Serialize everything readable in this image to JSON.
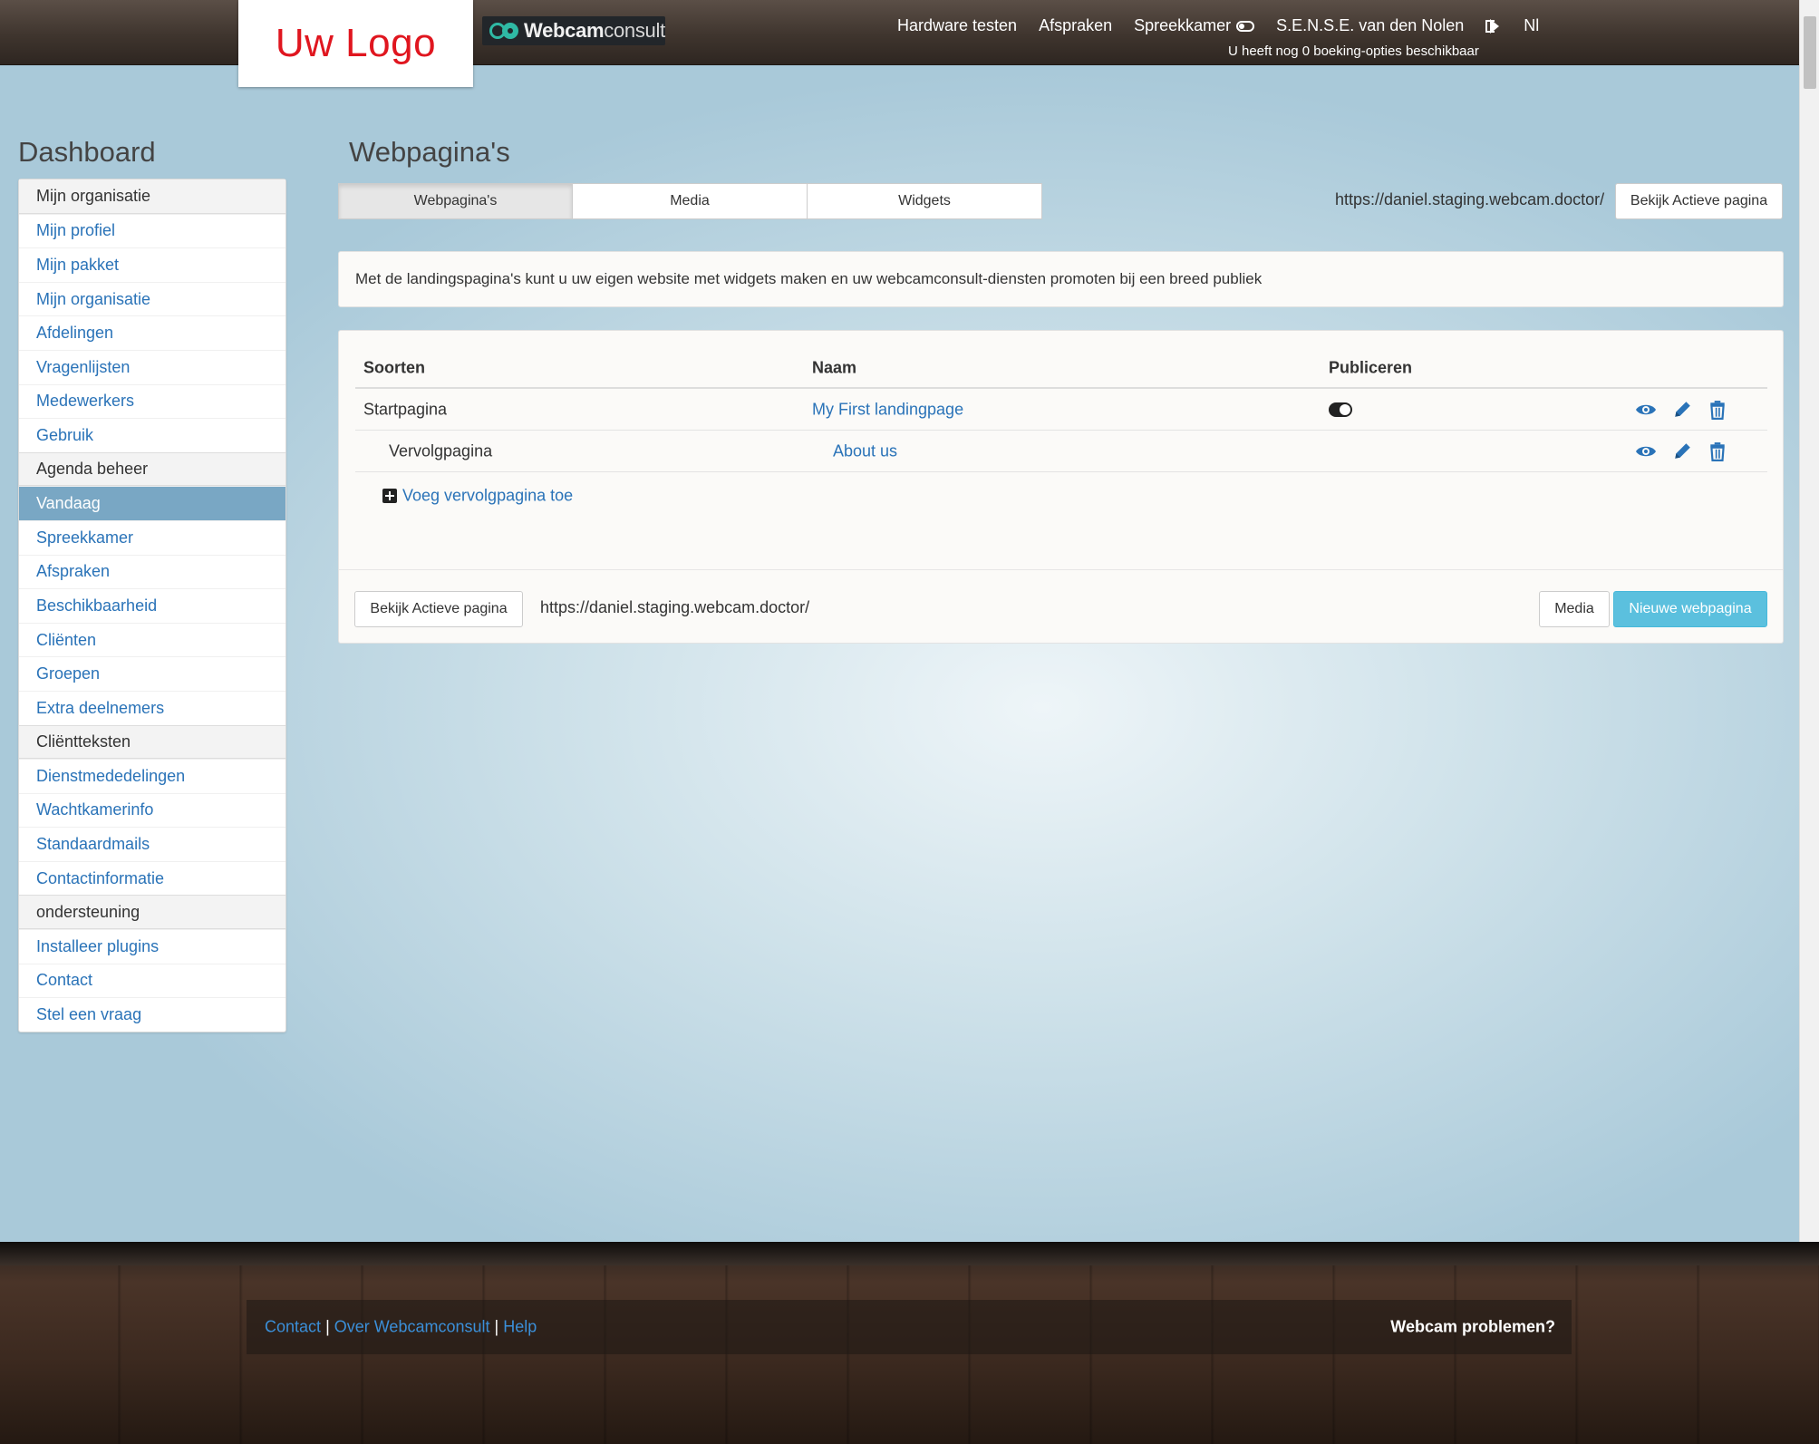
{
  "header": {
    "logo_text": "Uw Logo",
    "brand_bold": "Webcam",
    "brand_light": "consult",
    "nav": {
      "hardware": "Hardware testen",
      "afspraken": "Afspraken",
      "spreekkamer": "Spreekkamer",
      "user": "S.E.N.S.E. van den Nolen",
      "language": "Nl"
    },
    "booking_info": "U heeft nog 0 boeking-opties beschikbaar"
  },
  "sidebar": {
    "title": "Dashboard",
    "items": [
      {
        "label": "Mijn organisatie",
        "type": "header"
      },
      {
        "label": "Mijn profiel",
        "type": "link"
      },
      {
        "label": "Mijn pakket",
        "type": "link"
      },
      {
        "label": "Mijn organisatie",
        "type": "link"
      },
      {
        "label": "Afdelingen",
        "type": "link"
      },
      {
        "label": "Vragenlijsten",
        "type": "link"
      },
      {
        "label": "Medewerkers",
        "type": "link"
      },
      {
        "label": "Gebruik",
        "type": "link"
      },
      {
        "label": "Agenda beheer",
        "type": "header"
      },
      {
        "label": "Vandaag",
        "type": "active"
      },
      {
        "label": "Spreekkamer",
        "type": "link"
      },
      {
        "label": "Afspraken",
        "type": "link"
      },
      {
        "label": "Beschikbaarheid",
        "type": "link"
      },
      {
        "label": "Cliënten",
        "type": "link"
      },
      {
        "label": "Groepen",
        "type": "link"
      },
      {
        "label": "Extra deelnemers",
        "type": "link"
      },
      {
        "label": "Cliëntteksten",
        "type": "header"
      },
      {
        "label": "Dienstmededelingen",
        "type": "link"
      },
      {
        "label": "Wachtkamerinfo",
        "type": "link"
      },
      {
        "label": "Standaardmails",
        "type": "link"
      },
      {
        "label": "Contactinformatie",
        "type": "link"
      },
      {
        "label": "ondersteuning",
        "type": "header"
      },
      {
        "label": "Installeer plugins",
        "type": "link"
      },
      {
        "label": "Contact",
        "type": "link"
      },
      {
        "label": "Stel een vraag",
        "type": "link"
      }
    ]
  },
  "main": {
    "title": "Webpagina's",
    "tabs": [
      {
        "label": "Webpagina's",
        "active": true
      },
      {
        "label": "Media",
        "active": false
      },
      {
        "label": "Widgets",
        "active": false
      }
    ],
    "url": "https://daniel.staging.webcam.doctor/",
    "view_active_label": "Bekijk Actieve pagina",
    "info_text": "Met de landingspagina's kunt u uw eigen website met widgets maken en uw webcamconsult-diensten promoten bij een breed publiek",
    "table": {
      "columns": [
        "Soorten",
        "Naam",
        "Publiceren"
      ],
      "rows": [
        {
          "type": "Startpagina",
          "name": "My First landingpage",
          "published": true
        },
        {
          "type": "Vervolgpagina",
          "name": "About us",
          "published": false
        }
      ],
      "add_label": "Voeg vervolgpagina toe"
    },
    "footer": {
      "view_active_label": "Bekijk Actieve pagina",
      "url": "https://daniel.staging.webcam.doctor/",
      "media_label": "Media",
      "new_label": "Nieuwe webpagina"
    }
  },
  "footer": {
    "links": [
      "Contact",
      "Over Webcamconsult",
      "Help"
    ],
    "separator": "|",
    "problems": "Webcam problemen?"
  },
  "colors": {
    "accent": "#5bc0de",
    "link": "#2a73b8",
    "active_item": "#79a7c4",
    "logo_red": "#e0161f"
  }
}
